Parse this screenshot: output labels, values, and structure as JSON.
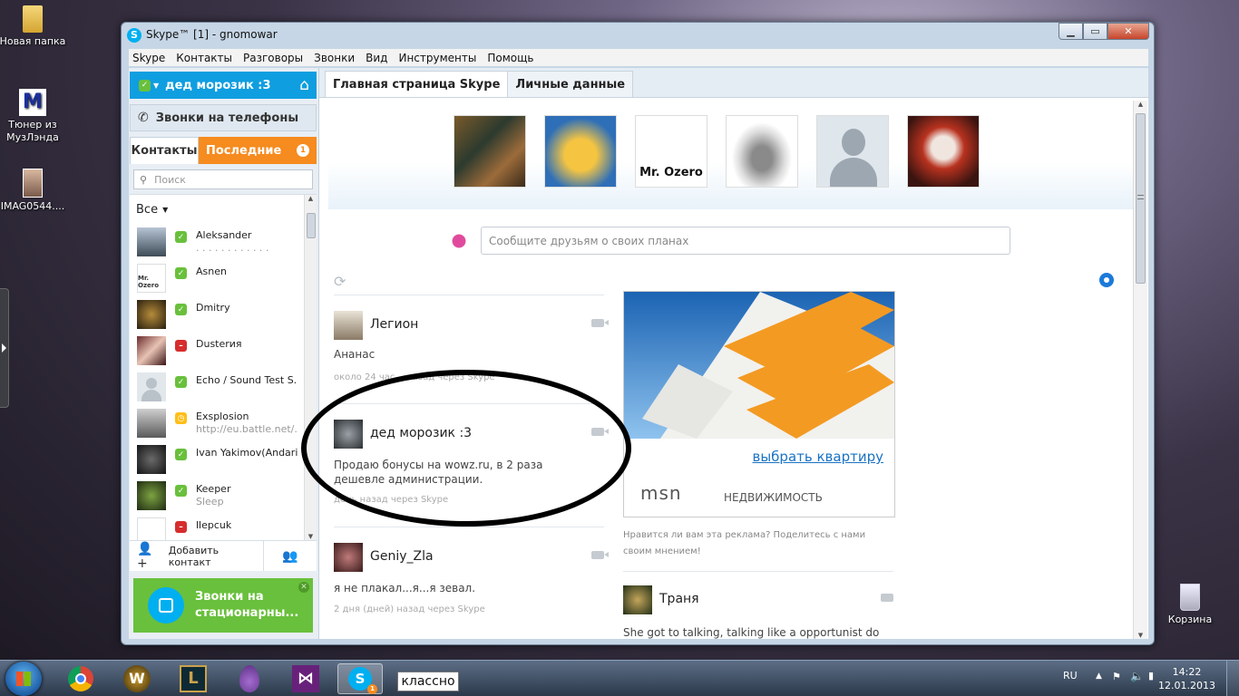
{
  "desktop": {
    "icons": [
      {
        "label": "Новая папка"
      },
      {
        "label": "Тюнер из МузЛэнда"
      },
      {
        "label": "IMAG0544...."
      },
      {
        "label": "Корзина"
      }
    ]
  },
  "window": {
    "title": "Skype™ [1] - gnomowar",
    "menu": [
      "Skype",
      "Контакты",
      "Разговоры",
      "Звонки",
      "Вид",
      "Инструменты",
      "Помощь"
    ]
  },
  "left": {
    "user_name": "дед морозик :3",
    "calls_label": "Звонки на телефоны",
    "tab_contacts": "Контакты",
    "tab_recent": "Последние",
    "recent_badge": "1",
    "search_placeholder": "Поиск",
    "filter_label": "Все",
    "contacts": [
      {
        "name": "Aleksander",
        "sub": ". . . . . . . . . . . .",
        "status": "online"
      },
      {
        "name": "Asnen",
        "sub": "",
        "status": "online"
      },
      {
        "name": "Dmitry",
        "sub": "",
        "status": "online"
      },
      {
        "name": "Dusterия",
        "sub": "",
        "status": "busy"
      },
      {
        "name": "Echo / Sound Test S...",
        "sub": "",
        "status": "online"
      },
      {
        "name": "Exsplosion",
        "sub": "http://eu.battle.net/...",
        "status": "away"
      },
      {
        "name": "Ivan Yakimov(Andari...",
        "sub": "",
        "status": "online"
      },
      {
        "name": "Keeper",
        "sub": "Sleep",
        "status": "online"
      },
      {
        "name": "llepcuk",
        "sub": "",
        "status": "busy"
      }
    ],
    "add_contact": "Добавить контакт",
    "promo_text": "Звонки на стационарны..."
  },
  "right": {
    "tab_home": "Главная страница Skype",
    "tab_profile": "Личные данные",
    "mood_placeholder": "Сообщите друзьям о своих планах",
    "feed": [
      {
        "name": "Легион",
        "text": "Ананас",
        "time": "около 24 час... назад через Skype"
      },
      {
        "name": "дед морозик :3",
        "text": "Продаю бонусы на wowz.ru, в 2 раза дешевле администрации.",
        "time": "день назад через Skype"
      },
      {
        "name": "Geniy_Zla",
        "text": "я не плакал...я...я зевал.",
        "time": "2 дня (дней) назад через Skype"
      }
    ],
    "ad": {
      "link": "выбрать квартиру",
      "brand": "msn",
      "brand_sub": "НЕДВИЖИМОСТЬ",
      "note": "Нравится ли вам эта реклама? Поделитесь с нами своим мнением!"
    },
    "feed2": {
      "name": "Траня",
      "text": "She got to talking, talking like a opportunist do"
    },
    "mr_ozero": "Mr. Ozero"
  },
  "taskbar": {
    "tooltip": "классно",
    "lang": "RU",
    "time": "14:22",
    "date": "12.01.2013"
  }
}
